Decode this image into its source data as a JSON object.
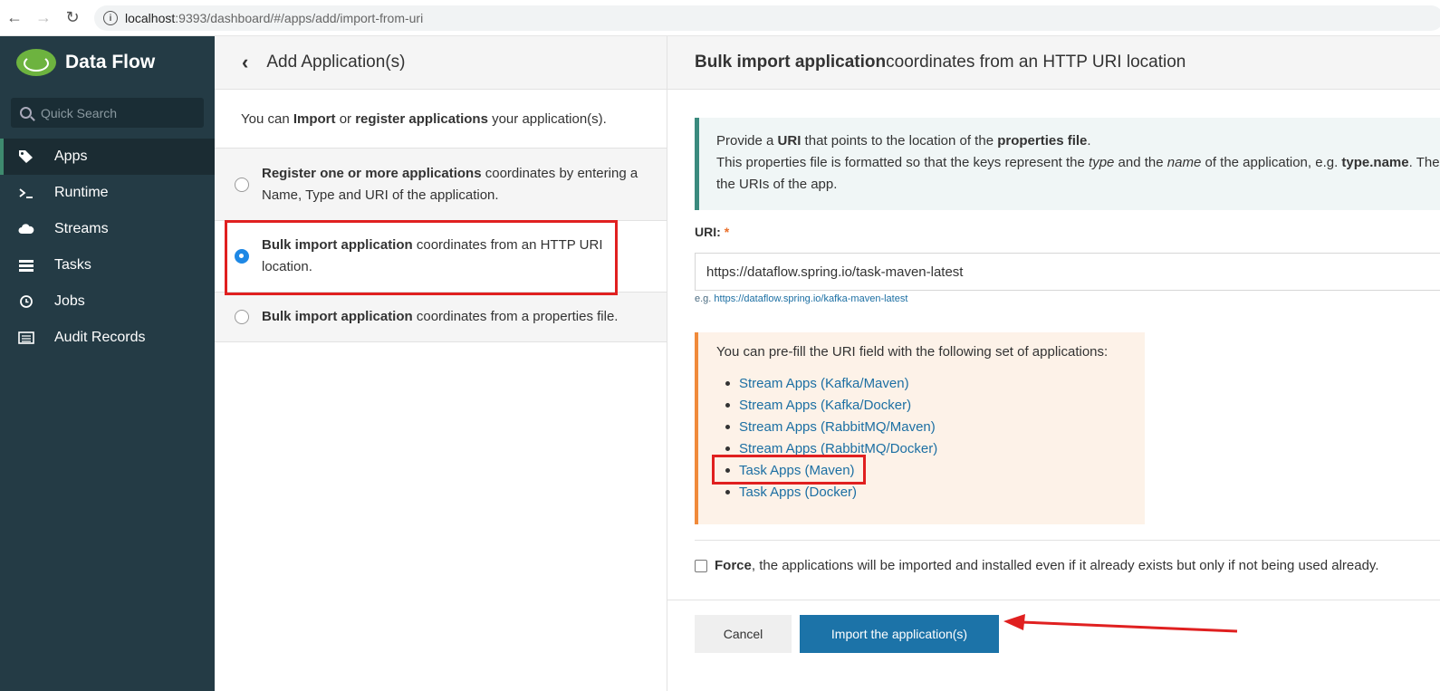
{
  "browser": {
    "url_host": "localhost",
    "url_path": ":9393/dashboard/#/apps/add/import-from-uri"
  },
  "sidebar": {
    "brand": "Data Flow",
    "search_placeholder": "Quick Search",
    "items": [
      {
        "label": "Apps",
        "icon": "tags-icon",
        "active": true
      },
      {
        "label": "Runtime",
        "icon": "terminal-icon"
      },
      {
        "label": "Streams",
        "icon": "cloud-icon"
      },
      {
        "label": "Tasks",
        "icon": "tasks-icon"
      },
      {
        "label": "Jobs",
        "icon": "clock-icon"
      },
      {
        "label": "Audit Records",
        "icon": "list-icon"
      }
    ]
  },
  "middle": {
    "title": "Add Application(s)",
    "intro": {
      "pre": "You can ",
      "b1": "Import",
      "mid": " or ",
      "b2": "register applications",
      "post": " your application(s)."
    },
    "options": [
      {
        "bold": "Register one or more applications",
        "rest": " coordinates by entering a Name, Type and URI of the application.",
        "checked": false
      },
      {
        "bold": "Bulk import application",
        "rest": " coordinates from an HTTP URI location.",
        "checked": true
      },
      {
        "bold": "Bulk import application",
        "rest": " coordinates from a properties file.",
        "checked": false
      }
    ]
  },
  "right": {
    "header_bold": "Bulk import application",
    "header_rest": " coordinates from an HTTP URI location",
    "info": {
      "l1_pre": "Provide a ",
      "l1_b1": "URI",
      "l1_mid": " that points to the location of the ",
      "l1_b2": "properties file",
      "l1_post": ".",
      "l2_pre": "This properties file is formatted so that the keys represent the ",
      "l2_i1": "type",
      "l2_mid": " and the ",
      "l2_i2": "name",
      "l2_post": " of the application, e.g. ",
      "l2_b": "type.name",
      "l2_end": ". The",
      "l3": "the URIs of the app."
    },
    "uri_label": "URI:",
    "uri_required": "*",
    "uri_value": "https://dataflow.spring.io/task-maven-latest",
    "uri_hint_prefix": "e.g. ",
    "uri_hint_link": "https://dataflow.spring.io/kafka-maven-latest",
    "prefill_text": "You can pre-fill the URI field with the following set of applications:",
    "prefill_links": [
      "Stream Apps (Kafka/Maven)",
      "Stream Apps (Kafka/Docker)",
      "Stream Apps (RabbitMQ/Maven)",
      "Stream Apps (RabbitMQ/Docker)",
      "Task Apps (Maven)",
      "Task Apps (Docker)"
    ],
    "force_bold": "Force",
    "force_rest": ", the applications will be imported and installed even if it already exists but only if not being used already.",
    "cancel_label": "Cancel",
    "import_label": "Import the application(s)"
  },
  "colors": {
    "sidebar_bg": "#243b45",
    "primary": "#1c73a8",
    "annotation": "#e02020",
    "warning": "#f08a3a"
  }
}
